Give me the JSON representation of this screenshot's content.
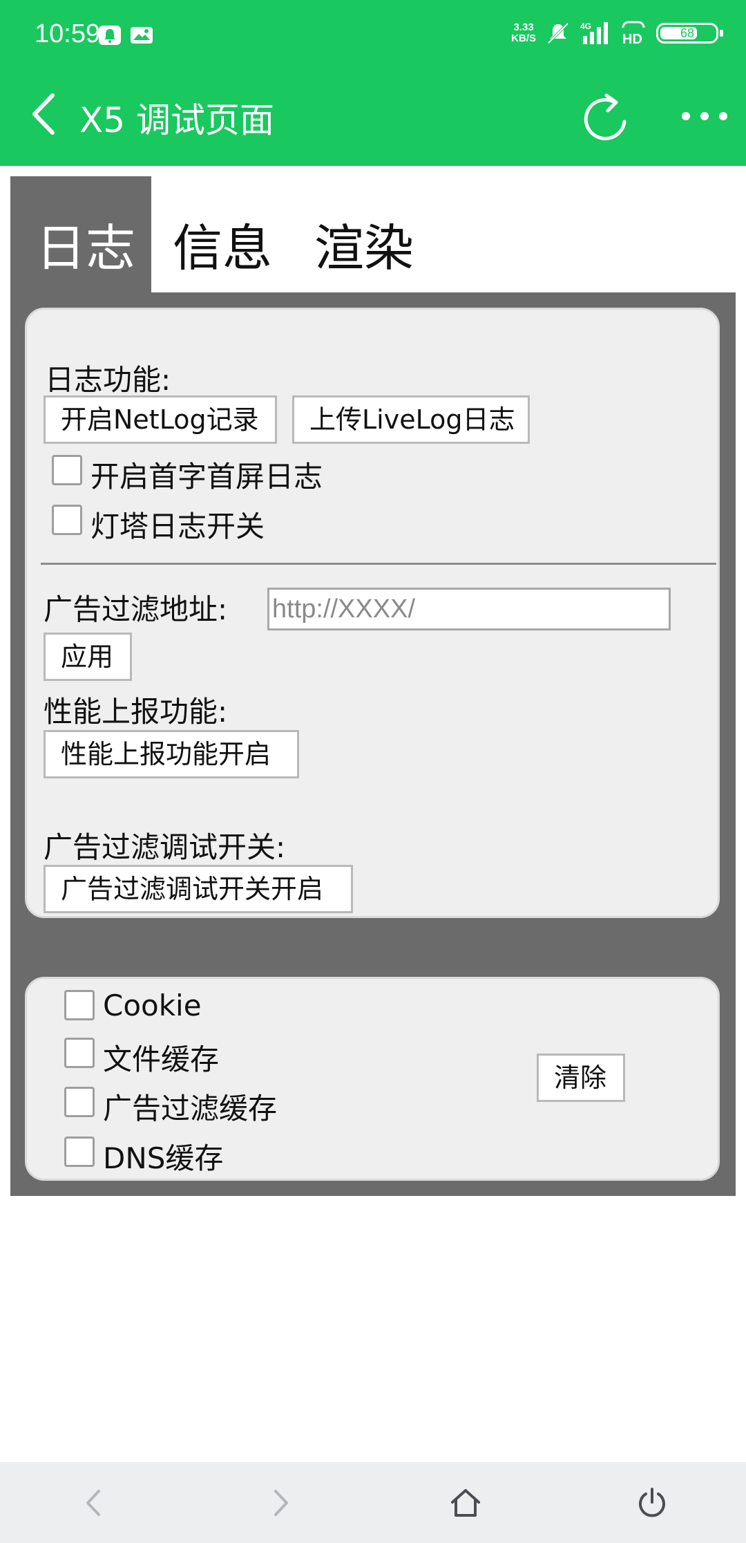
{
  "status_bar": {
    "time": "10:59",
    "speed_value": "3.33",
    "speed_unit": "KB/S",
    "network": "4G",
    "hd": "HD",
    "battery_level": "68",
    "battery_fraction": 0.68
  },
  "app_bar": {
    "title": "X5 调试页面",
    "icons": [
      "back-arrow",
      "refresh",
      "more-dots"
    ]
  },
  "tabs": [
    {
      "label": "日志",
      "active": true
    },
    {
      "label": "信息",
      "active": false
    },
    {
      "label": "渲染",
      "active": false
    }
  ],
  "log_panel": {
    "log_function_label": "日志功能:",
    "netlog_button": "开启NetLog记录",
    "livelog_button": "上传LiveLog日志",
    "first_screen_checkbox": "开启首字首屏日志",
    "beacon_checkbox": "灯塔日志开关",
    "ad_filter_label": "广告过滤地址:",
    "ad_filter_placeholder": "http://XXXX/",
    "apply_button": "应用",
    "perf_label": "性能上报功能:",
    "perf_button": "性能上报功能开启",
    "ad_debug_label": "广告过滤调试开关:",
    "ad_debug_button": "广告过滤调试开关开启"
  },
  "cache_panel": {
    "items": [
      {
        "label": "Cookie",
        "checked": false
      },
      {
        "label": "文件缓存",
        "checked": false
      },
      {
        "label": "广告过滤缓存",
        "checked": false
      },
      {
        "label": "DNS缓存",
        "checked": false
      }
    ],
    "clear_button": "清除"
  },
  "bottom_nav": [
    "back",
    "forward",
    "home",
    "power"
  ],
  "colors": {
    "app_bar": "#19c85f",
    "tab_strip": "#6b6b6b",
    "panel": "#efefef",
    "nav_bar": "#eceef0"
  }
}
